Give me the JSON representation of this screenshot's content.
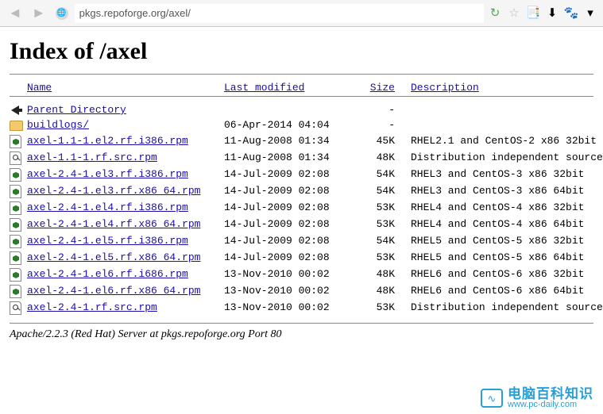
{
  "toolbar": {
    "url": "pkgs.repoforge.org/axel/"
  },
  "page": {
    "title": "Index of /axel",
    "server": "Apache/2.2.3 (Red Hat) Server at pkgs.repoforge.org Port 80"
  },
  "headers": {
    "name": "Name",
    "modified": "Last modified",
    "size": "Size",
    "description": "Description"
  },
  "parent": {
    "label": "Parent Directory",
    "size": "-"
  },
  "rows": [
    {
      "icon": "folder",
      "name": " buildlogs/",
      "modified": "06-Apr-2014 04:04",
      "size": "-",
      "desc": ""
    },
    {
      "icon": "pkg",
      "name": "axel-1.1-1.el2.rf.i386.rpm",
      "modified": "11-Aug-2008 01:34",
      "size": "45K",
      "desc": "RHEL2.1 and CentOS-2 x86 32bit"
    },
    {
      "icon": "src",
      "name": "axel-1.1-1.rf.src.rpm",
      "modified": "11-Aug-2008 01:34",
      "size": "48K",
      "desc": "Distribution independent source"
    },
    {
      "icon": "pkg",
      "name": "axel-2.4-1.el3.rf.i386.rpm",
      "modified": "14-Jul-2009 02:08",
      "size": "54K",
      "desc": "RHEL3 and CentOS-3 x86 32bit"
    },
    {
      "icon": "pkg",
      "name": "axel-2.4-1.el3.rf.x86_64.rpm",
      "modified": "14-Jul-2009 02:08",
      "size": "54K",
      "desc": "RHEL3 and CentOS-3 x86 64bit"
    },
    {
      "icon": "pkg",
      "name": "axel-2.4-1.el4.rf.i386.rpm",
      "modified": "14-Jul-2009 02:08",
      "size": "53K",
      "desc": "RHEL4 and CentOS-4 x86 32bit"
    },
    {
      "icon": "pkg",
      "name": "axel-2.4-1.el4.rf.x86_64.rpm",
      "modified": "14-Jul-2009 02:08",
      "size": "53K",
      "desc": "RHEL4 and CentOS-4 x86 64bit"
    },
    {
      "icon": "pkg",
      "name": "axel-2.4-1.el5.rf.i386.rpm",
      "modified": "14-Jul-2009 02:08",
      "size": "54K",
      "desc": "RHEL5 and CentOS-5 x86 32bit"
    },
    {
      "icon": "pkg",
      "name": "axel-2.4-1.el5.rf.x86_64.rpm",
      "modified": "14-Jul-2009 02:08",
      "size": "53K",
      "desc": "RHEL5 and CentOS-5 x86 64bit"
    },
    {
      "icon": "pkg",
      "name": "axel-2.4-1.el6.rf.i686.rpm",
      "modified": "13-Nov-2010 00:02",
      "size": "48K",
      "desc": "RHEL6 and CentOS-6 x86 32bit"
    },
    {
      "icon": "pkg",
      "name": "axel-2.4-1.el6.rf.x86_64.rpm",
      "modified": "13-Nov-2010 00:02",
      "size": "48K",
      "desc": "RHEL6 and CentOS-6 x86 64bit"
    },
    {
      "icon": "src",
      "name": "axel-2.4-1.rf.src.rpm",
      "modified": "13-Nov-2010 00:02",
      "size": "53K",
      "desc": "Distribution independent source"
    }
  ],
  "watermark": {
    "cn": "电脑百科知识",
    "url": "www.pc-daily.com"
  }
}
